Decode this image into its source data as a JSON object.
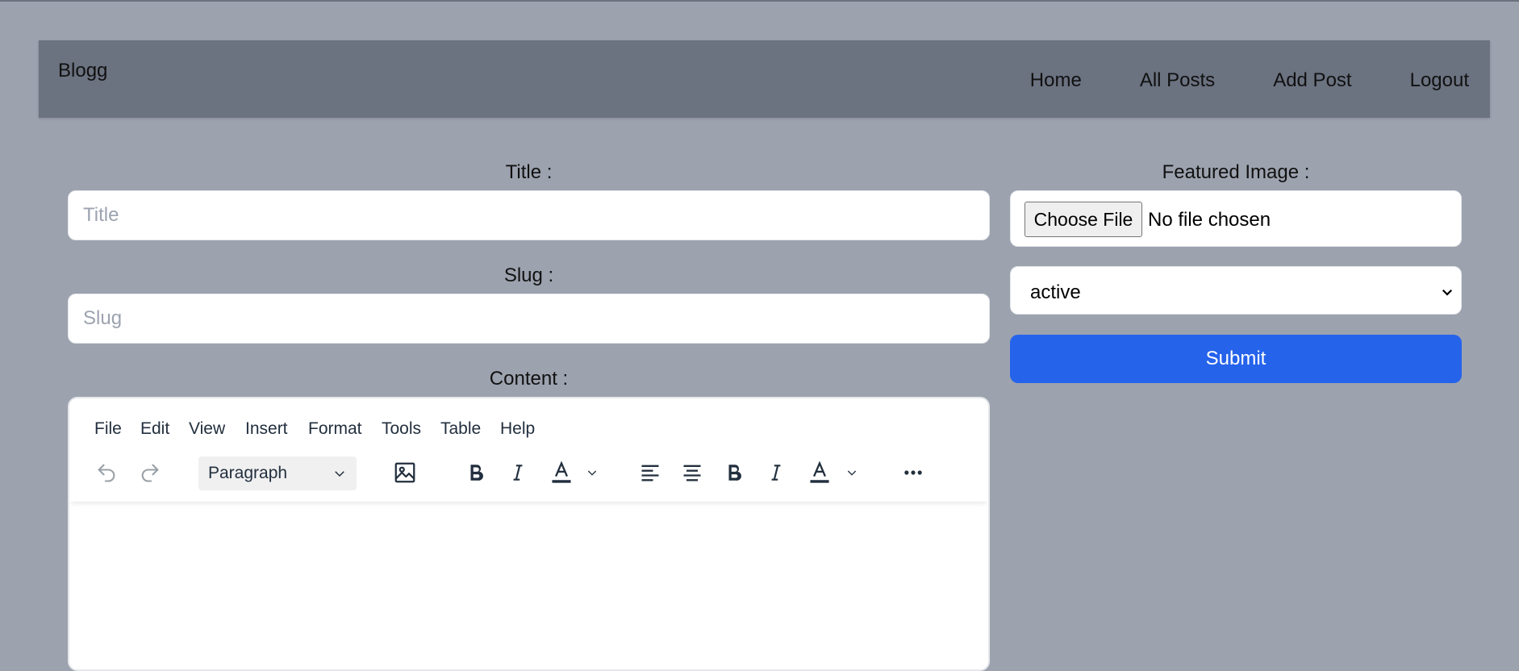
{
  "nav": {
    "brand": "Blogg",
    "links": [
      "Home",
      "All Posts",
      "Add Post",
      "Logout"
    ]
  },
  "form": {
    "title_label": "Title :",
    "title_placeholder": "Title",
    "slug_label": "Slug :",
    "slug_placeholder": "Slug",
    "content_label": "Content :",
    "featured_label": "Featured Image :",
    "file_button": "Choose File",
    "file_status": "No file chosen",
    "status_value": "active",
    "submit_label": "Submit"
  },
  "editor": {
    "menu": [
      "File",
      "Edit",
      "View",
      "Insert",
      "Format",
      "Tools",
      "Table",
      "Help"
    ],
    "block_format": "Paragraph",
    "toolbar_icons": [
      "undo-icon",
      "redo-icon",
      "image-icon",
      "bold-icon",
      "italic-icon",
      "text-color-icon",
      "align-left-icon",
      "align-center-icon",
      "bold-icon",
      "italic-icon",
      "text-color-icon",
      "more-icon"
    ]
  },
  "colors": {
    "background": "#9ca2ae",
    "navbar": "#6b7280",
    "primary": "#2563eb",
    "editor_text": "#222f3e"
  }
}
